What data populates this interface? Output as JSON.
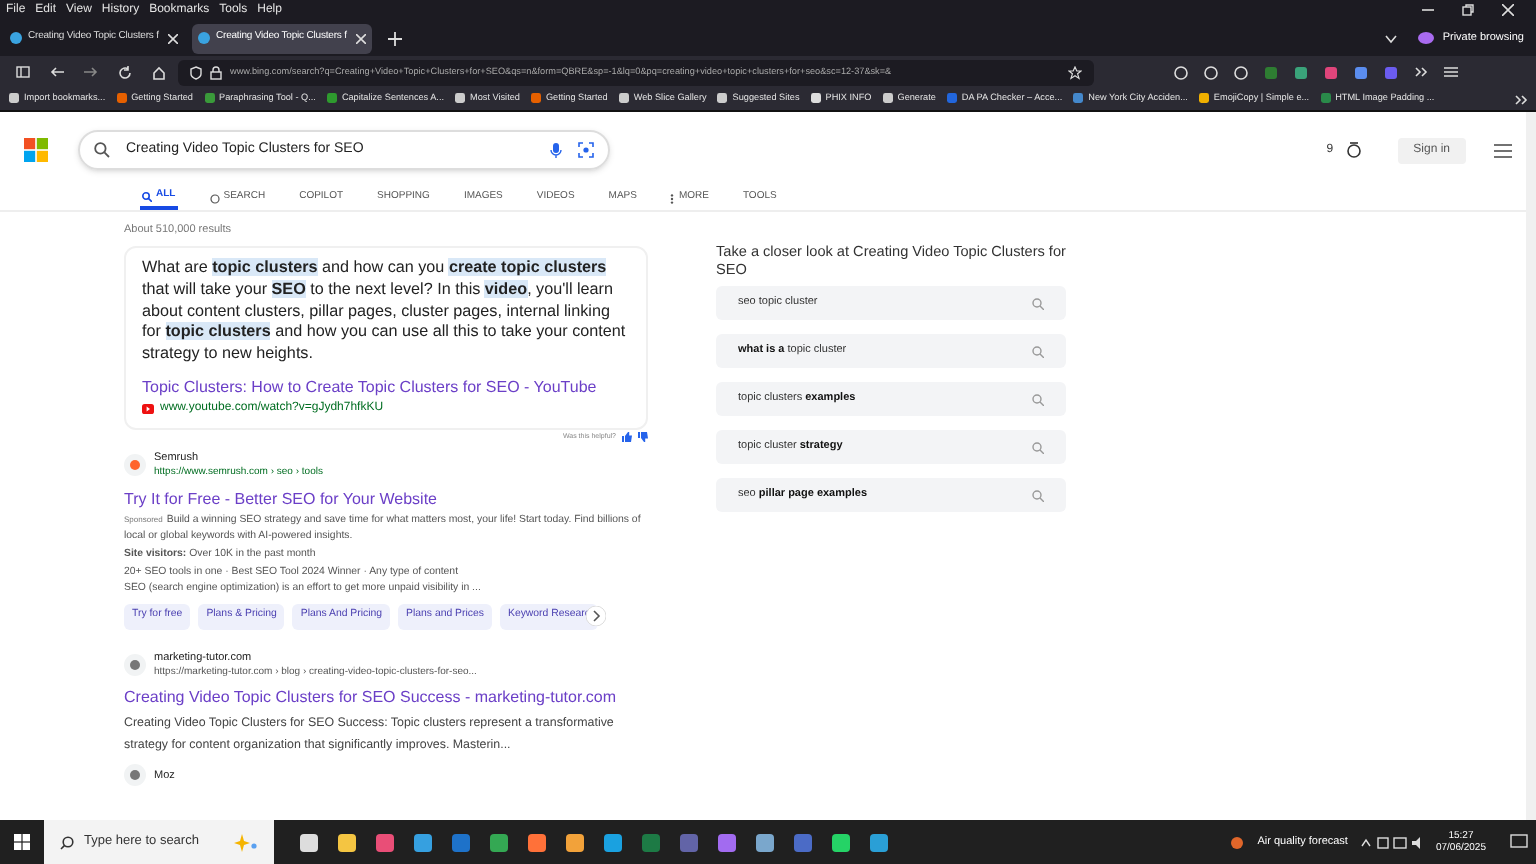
{
  "menu": [
    "File",
    "Edit",
    "View",
    "History",
    "Bookmarks",
    "Tools",
    "Help"
  ],
  "tabs": [
    {
      "title": "Creating Video Topic Clusters f",
      "selected": false
    },
    {
      "title": "Creating Video Topic Clusters f",
      "selected": true
    }
  ],
  "private_label": "Private browsing",
  "address": "www.bing.com/search?q=Creating+Video+Topic+Clusters+for+SEO&qs=n&form=QBRE&sp=-1&lq=0&pq=creating+video+topic+clusters+for+seo&sc=12-37&sk=&",
  "bookmarks": [
    "Import bookmarks...",
    "Getting Started",
    "Paraphrasing Tool - Q...",
    "Capitalize Sentences A...",
    "Most Visited",
    "Getting Started",
    "Web Slice Gallery",
    "Suggested Sites",
    "PHIX INFO",
    "Generate",
    "DA PA Checker – Acce...",
    "New York City Acciden...",
    "EmojiCopy | Simple e...",
    "HTML Image Padding ..."
  ],
  "search": {
    "query": "Creating Video Topic Clusters for SEO",
    "rewards": "9",
    "sign_in": "Sign in"
  },
  "nav": [
    {
      "label": "ALL",
      "selected": true
    },
    {
      "label": "SEARCH",
      "selected": false
    },
    {
      "label": "COPILOT",
      "selected": false
    },
    {
      "label": "SHOPPING",
      "selected": false
    },
    {
      "label": "IMAGES",
      "selected": false
    },
    {
      "label": "VIDEOS",
      "selected": false
    },
    {
      "label": "MAPS",
      "selected": false
    },
    {
      "label": "MORE",
      "selected": false
    },
    {
      "label": "TOOLS",
      "selected": false
    }
  ],
  "results_count": "About 510,000 results",
  "answer": {
    "text": "What are **topic clusters** and how can you **create topic clusters** that will take your **SEO** to the next level? In this **video**, you'll learn about content clusters, pillar pages, cluster pages, internal linking for **topic clusters** and how you can use all this to take your content strategy to new heights.",
    "title": "Topic Clusters: How to Create Topic Clusters for SEO - YouTube",
    "url": "www.youtube.com/watch?v=gJydh7hfkKU",
    "helpful": "Was this helpful?"
  },
  "results": [
    {
      "kind": "ad",
      "site": "Semrush",
      "url": "https://www.semrush.com › seo › tools",
      "title": "Try It for Free - Better SEO for Your Website",
      "badge": "Sponsored",
      "lines": [
        "Build a winning SEO strategy and save time for what matters most, your life! Start today. Find billions of local or global keywords with AI-powered insights.",
        "**Site visitors:** Over 10K in the past month",
        "20+ SEO tools in one · Best SEO Tool 2024 Winner · Any type of content",
        "SEO (search engine optimization) is an effort to get more unpaid visibility in ..."
      ],
      "chips": [
        "Try for free",
        "Plans & Pricing",
        "Plans And Pricing",
        "Plans and Prices",
        "Keyword Researc"
      ]
    },
    {
      "kind": "organic",
      "site": "marketing-tutor.com",
      "url": "https://marketing-tutor.com › blog › creating-video-topic-clusters-for-seo...",
      "title": "Creating Video Topic Clusters for SEO Success - marketing-tutor.com",
      "lines": [
        "Creating Video Topic Clusters for SEO Success: Topic clusters represent a transformative strategy for content organization that significantly improves. Masterin..."
      ]
    },
    {
      "kind": "organic",
      "site": "Moz"
    }
  ],
  "related": {
    "title": "Take a closer look at Creating Video Topic Clusters for SEO",
    "items": [
      "seo topic cluster",
      "**what is a** topic cluster",
      "topic clusters **examples**",
      "topic cluster **strategy**",
      "seo **pillar page examples**"
    ]
  },
  "taskbar": {
    "search_placeholder": "Type here to search",
    "weather": "Air quality forecast",
    "time": "15:27",
    "date": "07/06/2025"
  }
}
